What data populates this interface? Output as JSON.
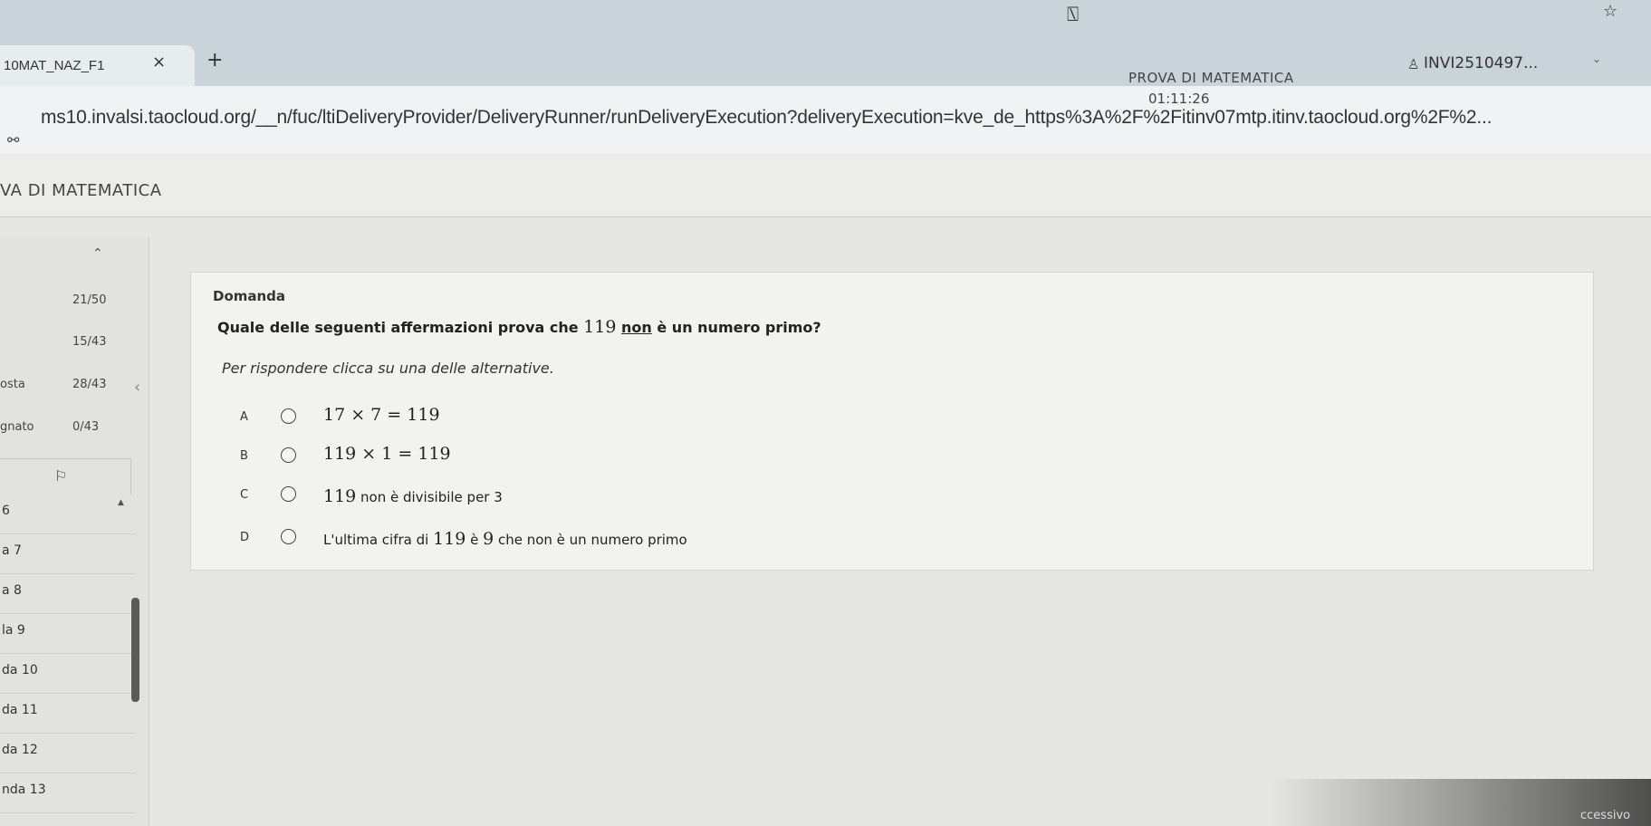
{
  "browser": {
    "tab_title": "10MAT_NAZ_F1",
    "tab_close": "×",
    "new_tab": "+",
    "url": "ms10.invalsi.taocloud.org/__n/fuc/ltiDeliveryProvider/DeliveryRunner/runDeliveryExecution?deliveryExecution=kve_de_https%3A%2F%2Fitinv07mtp.itinv.taocloud.org%2F%2...",
    "url_right_fragment": "",
    "site_icon": "⚯",
    "star_icon": "☆",
    "cursor_icon": "⍂"
  },
  "test": {
    "title": "VA DI MATEMATICA",
    "name": "PROVA DI MATEMATICA",
    "timer": "01:11:26",
    "user_icon": "♙",
    "user_id": "INVI2510497...",
    "user_chevron": "⌄"
  },
  "sidebar": {
    "up_icon": "⌃",
    "stats": [
      {
        "label": "",
        "value": "21/50"
      },
      {
        "label": "",
        "value": "15/43"
      },
      {
        "label": "osta",
        "value": "28/43"
      },
      {
        "label": "gnato",
        "value": "0/43"
      }
    ],
    "collapse_icon": "‹",
    "flag_icon": "⚐",
    "sort_icon": "▲",
    "items": [
      "6",
      "a 7",
      "a 8",
      "la 9",
      "da 10",
      "da 11",
      "da 12",
      "nda 13"
    ]
  },
  "question": {
    "heading": "Domanda",
    "text_before": "Quale delle seguenti affermazioni prova che ",
    "number": "119",
    "underlined": "non",
    "text_after": " è un numero primo?",
    "instruction": "Per rispondere clicca su una delle alternative.",
    "choices": [
      {
        "letter": "A",
        "text": "17 × 7 = 119"
      },
      {
        "letter": "B",
        "text": "119 × 1 = 119"
      },
      {
        "letter": "C",
        "num": "119",
        "text": " non è divisibile per 3"
      },
      {
        "letter": "D",
        "pre": "L'ultima cifra di ",
        "num": "119",
        "mid": " è ",
        "num2": "9",
        "text": " che non è un numero primo"
      }
    ]
  },
  "corner_text": "ccessivo"
}
